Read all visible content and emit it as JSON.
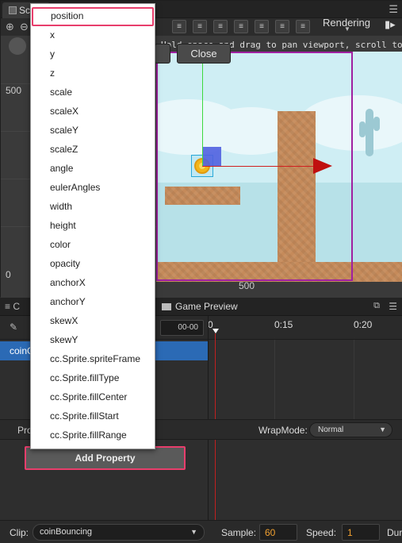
{
  "scene": {
    "tab_label": "Sc",
    "rendering_label": "Rendering",
    "hint_text": "Hold space and drag to pan viewport, scroll to zoom.",
    "axis_label_500_left": "500",
    "axis_label_0_left": "0",
    "axis_label_500_bottom": "500",
    "close_button": "Close"
  },
  "dropdown": {
    "items": [
      "position",
      "x",
      "y",
      "z",
      "scale",
      "scaleX",
      "scaleY",
      "scaleZ",
      "angle",
      "eulerAngles",
      "width",
      "height",
      "color",
      "opacity",
      "anchorX",
      "anchorY",
      "skewX",
      "skewY",
      "cc.Sprite.spriteFrame",
      "cc.Sprite.fillType",
      "cc.Sprite.fillCenter",
      "cc.Sprite.fillStart",
      "cc.Sprite.fillRange"
    ],
    "selected_index": 0
  },
  "animation": {
    "tab_left_prefix": "C",
    "game_preview_tab": "Game Preview",
    "time_field": "00-00",
    "ticks": [
      "0",
      "0:15",
      "0:20"
    ],
    "node_name": "coinC",
    "props_label": "Pro",
    "wrapmode_label": "WrapMode:",
    "wrapmode_value": "Normal",
    "add_property": "Add Property"
  },
  "footer": {
    "clip_label": "Clip:",
    "clip_value": "coinBouncing",
    "sample_label": "Sample:",
    "sample_value": "60",
    "speed_label": "Speed:",
    "speed_value": "1",
    "duration_label": "Dur"
  },
  "colors": {
    "accent_highlight": "#e83e6c",
    "selection_blue": "#2b6ab5",
    "number_orange": "#f0a030"
  }
}
